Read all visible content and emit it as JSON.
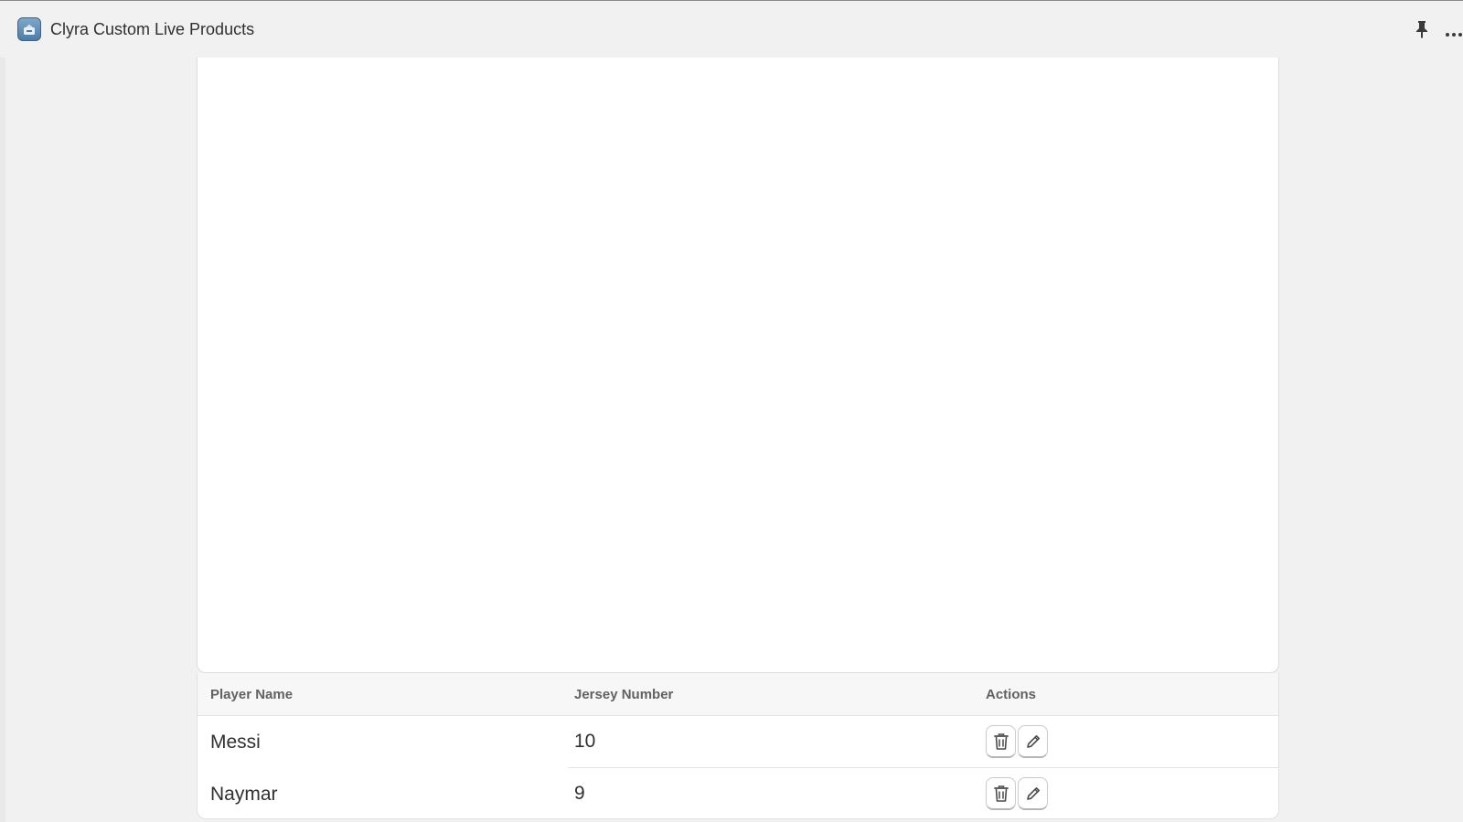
{
  "window": {
    "title": "Clyra Custom Live Products",
    "app_icon": "app-logo-icon",
    "controls": {
      "pin_icon": "pin-icon",
      "more_icon": "more-options-icon"
    }
  },
  "table": {
    "columns": {
      "player_name": "Player Name",
      "jersey_number": "Jersey Number",
      "actions": "Actions"
    },
    "rows": [
      {
        "player_name": "Messi",
        "jersey_number": "10"
      },
      {
        "player_name": "Naymar",
        "jersey_number": "9"
      }
    ],
    "row_actions": {
      "delete_icon": "trash-icon",
      "edit_icon": "pencil-icon"
    }
  },
  "colors": {
    "background": "#f1f1f1",
    "card": "#ffffff",
    "header_bg": "#f7f7f7",
    "text": "#303030",
    "header_text": "#616161"
  }
}
